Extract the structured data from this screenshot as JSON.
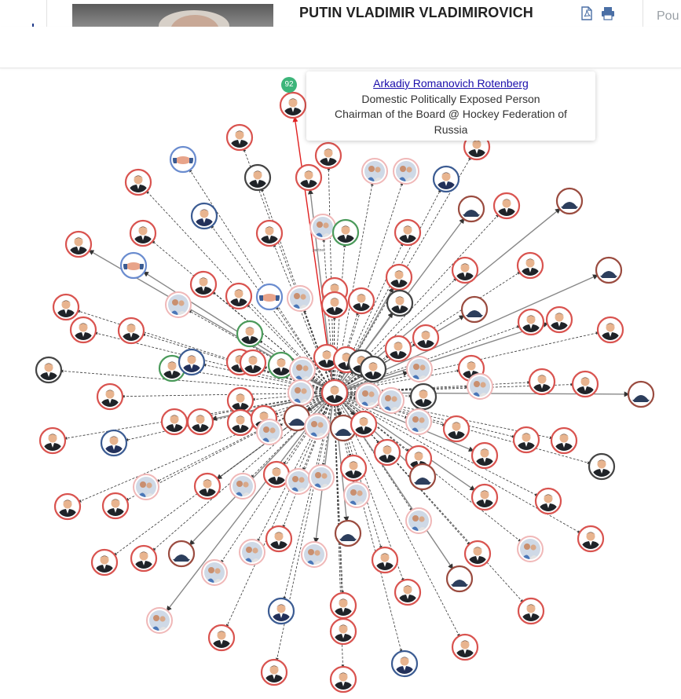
{
  "header": {
    "person_name": "PUTIN VLADIMIR VLADIMIROVICH",
    "pdf_icon": "pdf-icon",
    "print_icon": "printer-icon",
    "side_text": "Pou",
    "colors": {
      "icon_blue": "#4a6fa5",
      "title_text": "#222222"
    }
  },
  "graph": {
    "colors": {
      "pep_ring": "#d9534f",
      "neutral_ring": "#444444",
      "business_ring": "#3b5b92",
      "family_ring": "#f0b8b8",
      "related_ring": "#4a9a5a",
      "edge": "#333333",
      "highlight_edge": "#e02020"
    },
    "node_types": [
      "politician-node",
      "male-avatar-node",
      "family-node",
      "business-node",
      "organization-node",
      "handshake-node"
    ],
    "badge_text": "92",
    "tiny_label": "partner"
  },
  "tooltip": {
    "name": "Arkadiy Romanovich Rotenberg",
    "category": "Domestic Politically Exposed Person",
    "role": "Chairman of the Board @ Hockey Federation of Russia"
  }
}
